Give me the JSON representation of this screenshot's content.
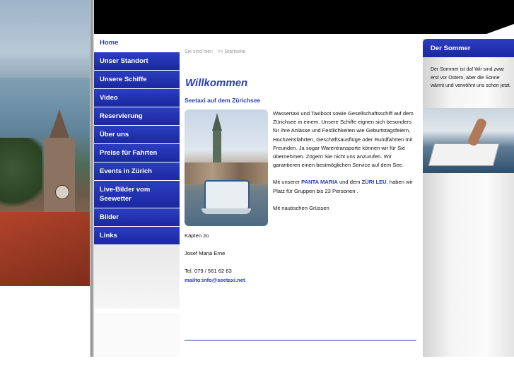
{
  "nav": {
    "items": [
      {
        "label": "Home",
        "active": true
      },
      {
        "label": "Unser Standort"
      },
      {
        "label": "Unsere Schiffe"
      },
      {
        "label": "Video"
      },
      {
        "label": "Reservierung"
      },
      {
        "label": "Über uns"
      },
      {
        "label": "Preise für Fahrten"
      },
      {
        "label": "Events in Zürich"
      },
      {
        "label": "Live-Bilder vom Seewetter"
      },
      {
        "label": "Bilder"
      },
      {
        "label": "Links"
      }
    ]
  },
  "breadcrumb": {
    "prefix": "Sie sind hier:",
    "current": ">> Startseite"
  },
  "main": {
    "title": "Willkommen",
    "subtitle": "Seetaxi auf dem Zürichsee",
    "paragraph1": "Wassertaxi und Taxiboot sowie Gesellschaftsschiff auf dem Zürichsee in einem. Unsere Schiffe eignen sich besonders für Ihre Anlässe und Festlichkeiten wie Geburtstagsfeiern, Hochzeitsfahrten, Geschäftsausflüge oder Rundfahrten mit Freunden. Ja sogar Warentransporte können wir für Sie übernehmen. Zögern Sie nicht uns anzurufen. Wir garantieren einen bestmöglichen Service auf dem See.",
    "paragraph2_a": "Mit unserer ",
    "paragraph2_boat1": "PANTA MARIA",
    "paragraph2_b": " und dem ",
    "paragraph2_boat2": "ZÜRI LEU",
    "paragraph2_c": ", haben wir Platz für Gruppen bis 23 Personen .",
    "paragraph3": "Mit nautischen Grüssen",
    "sig1": "Käpten Jo",
    "sig2": "Josef Maria Erne",
    "phone": "Tel. 079 / 561 62 63",
    "mail": "mailto:info@seetaxi.net"
  },
  "sidebar": {
    "title": "Der Sommer",
    "text": "Der Sommer ist da! Wir sind zwar erst vor Ostern, aber die Sonne wärmt und verwöhnt uns schon jetzt."
  }
}
